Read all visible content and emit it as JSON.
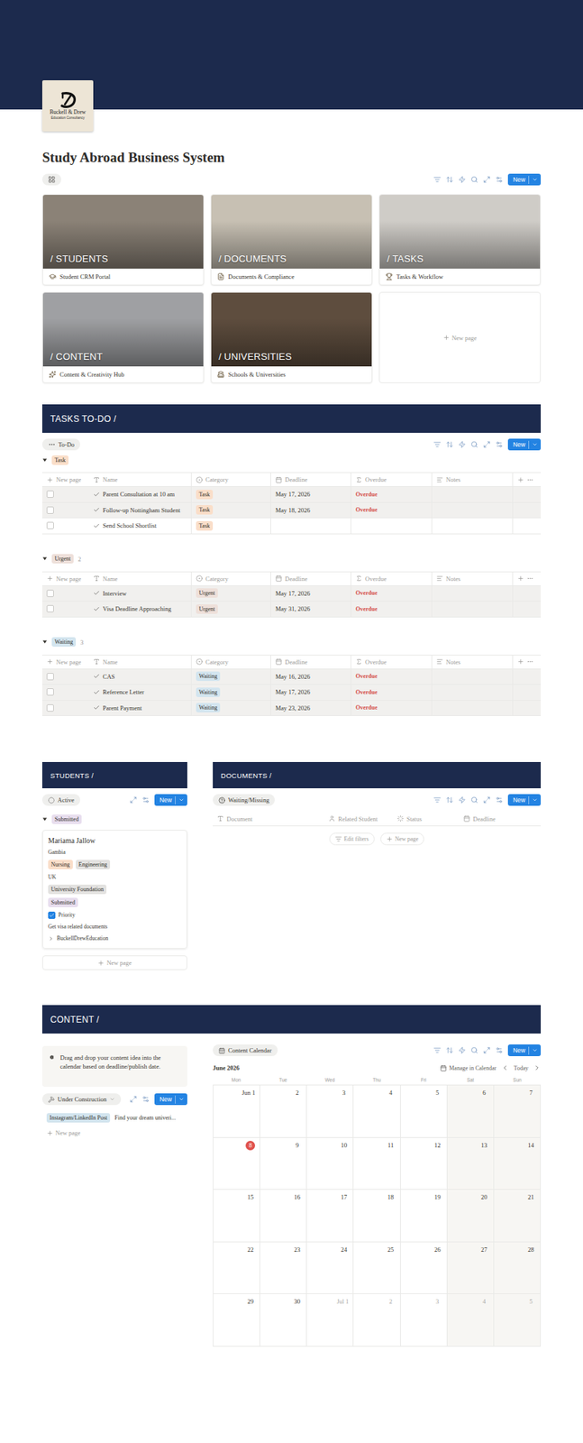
{
  "header": {
    "logo": {
      "name": "Buckell & Drew",
      "tagline": "Education Consultancy"
    },
    "title": "Study Abroad Business System"
  },
  "gallery": {
    "new_button": "New",
    "cards": [
      {
        "cover_label": "/ STUDENTS",
        "title": "Student CRM Portal"
      },
      {
        "cover_label": "/ DOCUMENTS",
        "title": "Documents & Compliance"
      },
      {
        "cover_label": "/ TASKS",
        "title": "Tasks & Workflow"
      },
      {
        "cover_label": "/ CONTENT",
        "title": "Content & Creativity Hub"
      },
      {
        "cover_label": "/ UNIVERSITIES",
        "title": "Schools & Universities"
      }
    ],
    "new_page": "New page"
  },
  "tasks": {
    "heading": "TASKS TO-DO /",
    "view": "To-Do",
    "new_button": "New",
    "new_page": "New page",
    "columns": [
      "Name",
      "Category",
      "Deadline",
      "Overdue",
      "Notes"
    ],
    "groups": [
      {
        "label": "Task",
        "color": "#fadec9",
        "expanded": true,
        "rows": [
          {
            "name": "Parent Consultation at 10 am",
            "category": "Task",
            "deadline": "May 17, 2026",
            "overdue": "Overdue",
            "checked": false,
            "highlighted": true
          },
          {
            "name": "Follow-up Nottingham Student",
            "category": "Task",
            "deadline": "May 18, 2026",
            "overdue": "Overdue",
            "checked": false,
            "highlighted": true
          },
          {
            "name": "Send School Shortlist",
            "category": "Task",
            "checked": false,
            "highlighted": false
          }
        ]
      },
      {
        "label": "Urgent",
        "count": "2",
        "color": "#eee0da",
        "expanded": true,
        "rows": [
          {
            "name": "Interview",
            "category": "Urgent",
            "deadline": "May 17, 2026",
            "overdue": "Overdue",
            "checked": false,
            "highlighted": true
          },
          {
            "name": "Visa Deadline Approaching",
            "category": "Urgent",
            "deadline": "May 31, 2026",
            "overdue": "Overdue",
            "checked": false,
            "highlighted": true
          }
        ]
      },
      {
        "label": "Waiting",
        "count": "3",
        "color": "#d3e5ef",
        "expanded": true,
        "rows": [
          {
            "name": "CAS",
            "category": "Waiting",
            "deadline": "May 16, 2026",
            "overdue": "Overdue",
            "checked": false,
            "highlighted": true
          },
          {
            "name": "Reference Letter",
            "category": "Waiting",
            "deadline": "May 17, 2026",
            "overdue": "Overdue",
            "checked": false,
            "highlighted": true
          },
          {
            "name": "Parent Payment",
            "category": "Waiting",
            "deadline": "May 23, 2026",
            "overdue": "Overdue",
            "checked": false,
            "highlighted": true
          }
        ]
      }
    ]
  },
  "students": {
    "heading": "STUDENTS /",
    "view": "Active",
    "new_button": "New",
    "group": {
      "label": "Submitted",
      "color": "#e8deee",
      "expanded": true
    },
    "cards": [
      {
        "name": "Mariama Jallow",
        "country": "Gambia",
        "subjects": [
          {
            "label": "Nursing",
            "color": "#fadec9"
          },
          {
            "label": "Engineering",
            "color": "#e3e2e0"
          }
        ],
        "destination": "UK",
        "program": {
          "label": "University Foundation",
          "color": "#e3e2e0"
        },
        "status": {
          "label": "Submitted",
          "color": "#e8deee"
        },
        "priority": {
          "label": "Priority",
          "checked": true
        },
        "next_step": "Get visa related documents",
        "relation": "BuckellDrewEducation"
      }
    ],
    "new_page": "New page"
  },
  "documents": {
    "heading": "DOCUMENTS /",
    "view": "Waiting/Missing",
    "new_button": "New",
    "columns": [
      "Document",
      "Related Student",
      "Status",
      "Deadline"
    ],
    "actions": [
      "Edit filters",
      "New page"
    ]
  },
  "content": {
    "heading": "CONTENT /",
    "callout": "Drag and drop your content idea into the calendar based on deadline/publish date.",
    "board": {
      "view": "Under Construction",
      "new_button": "New",
      "items": [
        {
          "tag": "Instagram/LinkedIn Post",
          "color": "#d3e5ef",
          "title": "Find your dream univeri..."
        }
      ],
      "new_page": "New page"
    },
    "calendar": {
      "view": "Content Calendar",
      "new_button": "New",
      "month": "June 2026",
      "manage": "Manage in Calendar",
      "today": "Today",
      "weekdays": [
        {
          "label": "Mon",
          "weekend": false
        },
        {
          "label": "Tue",
          "weekend": false
        },
        {
          "label": "Wed",
          "weekend": false
        },
        {
          "label": "Thu",
          "weekend": false
        },
        {
          "label": "Fri",
          "weekend": false
        },
        {
          "label": "Sat",
          "weekend": true
        },
        {
          "label": "Sun",
          "weekend": true
        }
      ],
      "weeks": [
        [
          {
            "label": "Jun 1",
            "muted": false,
            "today": false
          },
          {
            "label": "2",
            "muted": false,
            "today": false
          },
          {
            "label": "3",
            "muted": false,
            "today": false
          },
          {
            "label": "4",
            "muted": false,
            "today": false
          },
          {
            "label": "5",
            "muted": false,
            "today": false
          },
          {
            "label": "6",
            "muted": false,
            "today": false
          },
          {
            "label": "7",
            "muted": false,
            "today": false
          }
        ],
        [
          {
            "label": "8",
            "muted": false,
            "today": true
          },
          {
            "label": "9",
            "muted": false,
            "today": false
          },
          {
            "label": "10",
            "muted": false,
            "today": false
          },
          {
            "label": "11",
            "muted": false,
            "today": false
          },
          {
            "label": "12",
            "muted": false,
            "today": false
          },
          {
            "label": "13",
            "muted": false,
            "today": false
          },
          {
            "label": "14",
            "muted": false,
            "today": false
          }
        ],
        [
          {
            "label": "15",
            "muted": false,
            "today": false
          },
          {
            "label": "16",
            "muted": false,
            "today": false
          },
          {
            "label": "17",
            "muted": false,
            "today": false
          },
          {
            "label": "18",
            "muted": false,
            "today": false
          },
          {
            "label": "19",
            "muted": false,
            "today": false
          },
          {
            "label": "20",
            "muted": false,
            "today": false
          },
          {
            "label": "21",
            "muted": false,
            "today": false
          }
        ],
        [
          {
            "label": "22",
            "muted": false,
            "today": false
          },
          {
            "label": "23",
            "muted": false,
            "today": false
          },
          {
            "label": "24",
            "muted": false,
            "today": false
          },
          {
            "label": "25",
            "muted": false,
            "today": false
          },
          {
            "label": "26",
            "muted": false,
            "today": false
          },
          {
            "label": "27",
            "muted": false,
            "today": false
          },
          {
            "label": "28",
            "muted": false,
            "today": false
          }
        ],
        [
          {
            "label": "29",
            "muted": false,
            "today": false
          },
          {
            "label": "30",
            "muted": false,
            "today": false
          },
          {
            "label": "Jul 1",
            "muted": true,
            "today": false
          },
          {
            "label": "2",
            "muted": true,
            "today": false
          },
          {
            "label": "3",
            "muted": true,
            "today": false
          },
          {
            "label": "4",
            "muted": true,
            "today": false
          },
          {
            "label": "5",
            "muted": true,
            "today": false
          }
        ]
      ]
    }
  }
}
